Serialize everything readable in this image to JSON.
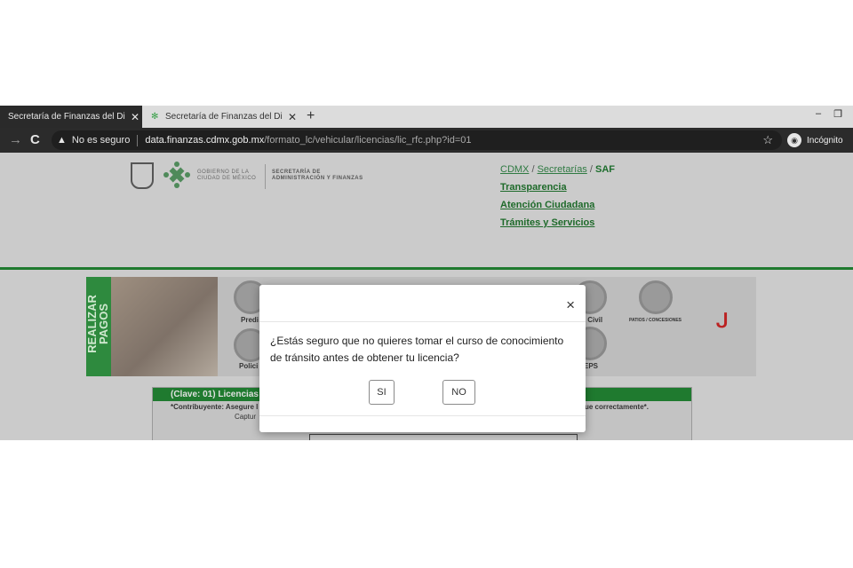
{
  "browser": {
    "tabs": [
      {
        "title": "Secretaría de Finanzas del Distrito Federal",
        "close": "✕"
      },
      {
        "title": "Secretaría de Finanzas del Distrito Federal",
        "close": "✕"
      }
    ],
    "new_tab": "+",
    "window_controls": [
      "–",
      "❐"
    ],
    "nav": {
      "back": "←",
      "forward": "→",
      "reload": "C"
    },
    "security_warning": "No es seguro",
    "url_host": "data.finanzas.cdmx.gob.mx",
    "url_path": "/formato_lc/vehicular/licencias/lic_rfc.php?id=01",
    "bookmark_icon": "star-icon",
    "incognito_label": "Incógnito"
  },
  "page": {
    "logo_text": {
      "gov_line1": "GOBIERNO DE LA",
      "gov_line2": "CIUDAD DE MÉXICO",
      "secretaria_line1": "SECRETARÍA DE",
      "secretaria_line2": "ADMINISTRACIÓN Y FINANZAS"
    },
    "breadcrumb": {
      "cdmx": "CDMX",
      "sep": " / ",
      "secretarias": "Secretarías",
      "current": "SAF"
    },
    "links": [
      "Transparencia",
      "Atención Ciudadana",
      "Trámites y Servicios"
    ],
    "banner": {
      "realizar": "REALIZAR",
      "pagos": "PAGOS",
      "labels": [
        "Predi",
        "ro Civil",
        "PATIOS / CONCESIONES",
        "Polici",
        "EPS"
      ]
    },
    "licencias": {
      "header": "(Clave: 01) Licencias",
      "note_left": "*Contribuyente: Asegure l",
      "note_right": "ue correctamente*.",
      "capture": "Captur"
    }
  },
  "modal": {
    "close": "×",
    "message": "¿Estás seguro que no quieres tomar el curso de conocimiento de tránsito antes de obtener tu licencia?",
    "yes": "SI",
    "no": "NO"
  }
}
